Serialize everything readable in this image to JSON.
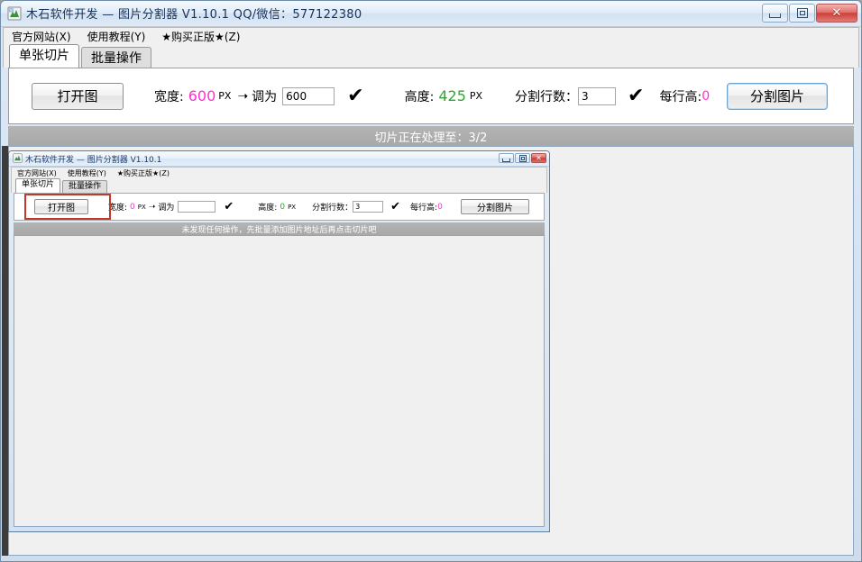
{
  "outer_window": {
    "icon": "app-icon",
    "title": "木石软件开发 — 图片分割器 V1.10.1    QQ/微信：577122380",
    "controls": {
      "minimize": "minimize-icon",
      "maximize": "restore-icon",
      "close": "✕"
    },
    "menu": [
      {
        "label": "官方网站(X)"
      },
      {
        "label": "使用教程(Y)"
      },
      {
        "label": "★购买正版★(Z)"
      }
    ],
    "tabs": [
      {
        "label": "单张切片",
        "active": true
      },
      {
        "label": "批量操作",
        "active": false
      }
    ],
    "toolbar": {
      "open_button": "打开图",
      "width_label": "宽度:",
      "width_value": "600",
      "width_unit": "PX",
      "arrow": "➝",
      "resize_label": "调为",
      "resize_value": "600",
      "confirm_check": "✔",
      "height_label": "高度:",
      "height_value": "425",
      "height_unit": "PX",
      "rows_label": "分割行数：",
      "rows_value": "3",
      "rows_check": "✔",
      "per_row_label": "每行高:",
      "per_row_value": "0",
      "split_button": "分割图片"
    },
    "status": "切片正在处理至：3/2"
  },
  "inner_window": {
    "icon": "app-icon",
    "title": "木石软件开发 — 图片分割器 V1.10.1",
    "controls": {
      "minimize": "minimize-icon",
      "maximize": "restore-icon",
      "close": "✕"
    },
    "menu": [
      {
        "label": "官方网站(X)"
      },
      {
        "label": "使用教程(Y)"
      },
      {
        "label": "★购买正版★(Z)"
      }
    ],
    "tabs": [
      {
        "label": "单张切片",
        "active": true
      },
      {
        "label": "批量操作",
        "active": false
      }
    ],
    "toolbar": {
      "open_button": "打开图",
      "width_label": "宽度:",
      "width_value": "0",
      "width_unit": "PX",
      "arrow": "➝",
      "resize_label": "调为",
      "resize_value": "",
      "confirm_check": "✔",
      "height_label": "高度:",
      "height_value": "0",
      "height_unit": "PX",
      "rows_label": "分割行数：",
      "rows_value": "3",
      "rows_check": "✔",
      "per_row_label": "每行高:",
      "per_row_value": "0",
      "split_button": "分割图片"
    },
    "status": "未发现任何操作，先批量添加图片地址后再点击切片吧"
  },
  "colors": {
    "pink_value": "#ff2fd0",
    "green_value": "#2fa62f",
    "status_bar": "#a8a8a8",
    "highlight_box": "#c0392b",
    "focus_border": "#6ba3d6"
  }
}
